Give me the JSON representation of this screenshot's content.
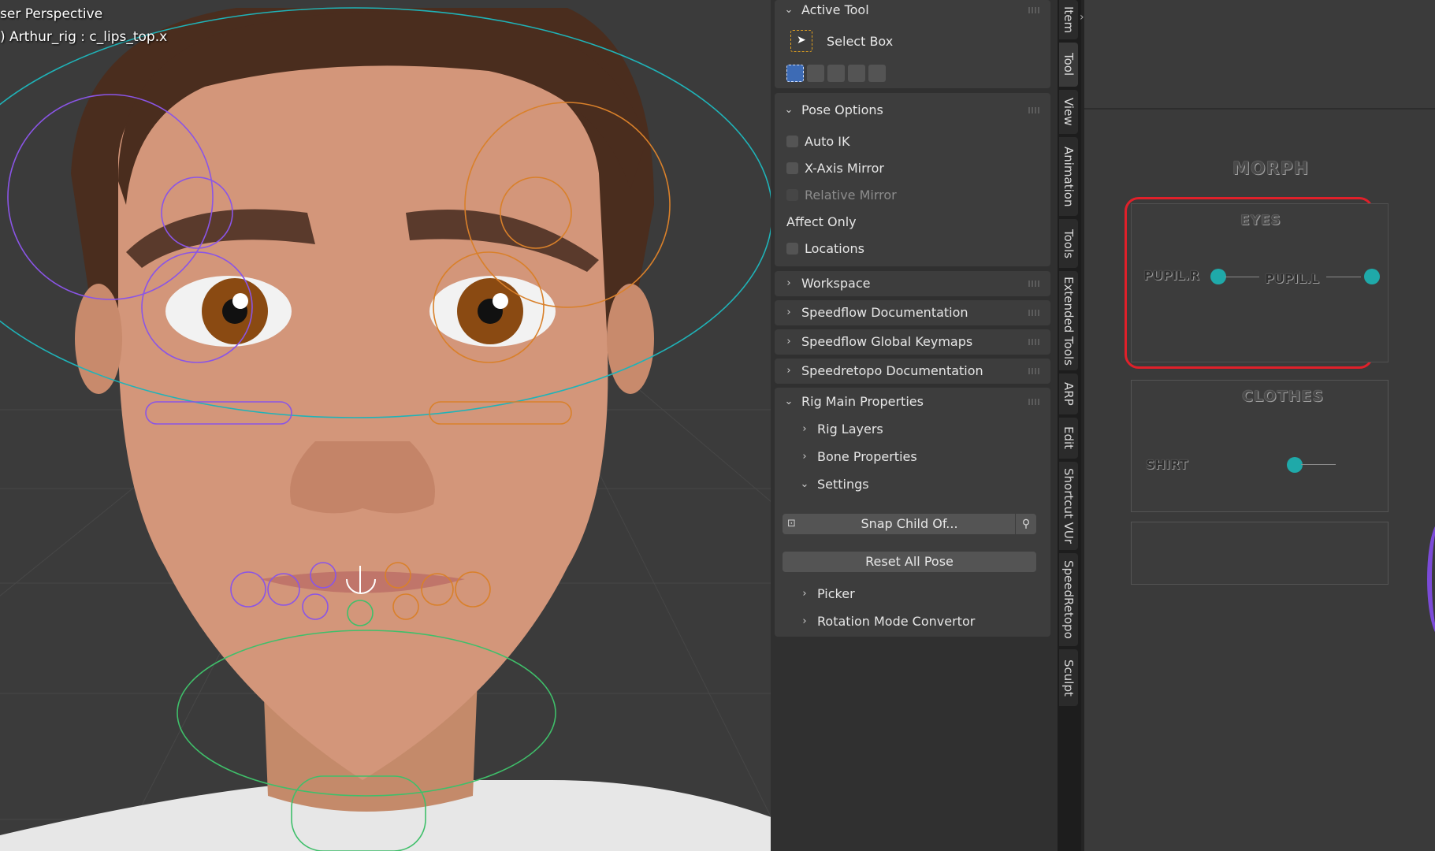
{
  "viewport": {
    "mode_label": "ser Perspective",
    "object_label": ") Arthur_rig : c_lips_top.x"
  },
  "active_tool": {
    "header": "Active Tool",
    "tool_name": "Select Box"
  },
  "pose_options": {
    "header": "Pose Options",
    "auto_ik": "Auto IK",
    "x_axis_mirror": "X-Axis Mirror",
    "relative_mirror": "Relative Mirror",
    "affect_only": "Affect Only",
    "locations": "Locations"
  },
  "panels": {
    "workspace": "Workspace",
    "speedflow_docs": "Speedflow Documentation",
    "speedflow_keymaps": "Speedflow Global Keymaps",
    "speedretopo_docs": "Speedretopo Documentation",
    "rig_main": "Rig Main Properties"
  },
  "rig_main": {
    "rig_layers": "Rig Layers",
    "bone_properties": "Bone Properties",
    "settings": "Settings",
    "snap_child_of": "Snap Child Of...",
    "reset_all_pose": "Reset All Pose",
    "picker": "Picker",
    "rotation_mode_convertor": "Rotation Mode Convertor"
  },
  "tabs": [
    "Item",
    "Tool",
    "View",
    "Animation",
    "Tools",
    "Extended Tools",
    "ARP",
    "Edit",
    "Shortcut VUr",
    "SpeedRetopo",
    "Sculpt"
  ],
  "active_tab": "Tool",
  "picker": {
    "title": "MORPH",
    "eyes_title": "EYES",
    "pupil_r": "PUPIL.R",
    "pupil_l": "PUPIL.L",
    "clothes_title": "CLOTHES",
    "shirt": "SHIRT",
    "highlight_color": "#e0202a",
    "knob_color": "#1fa9a9"
  }
}
